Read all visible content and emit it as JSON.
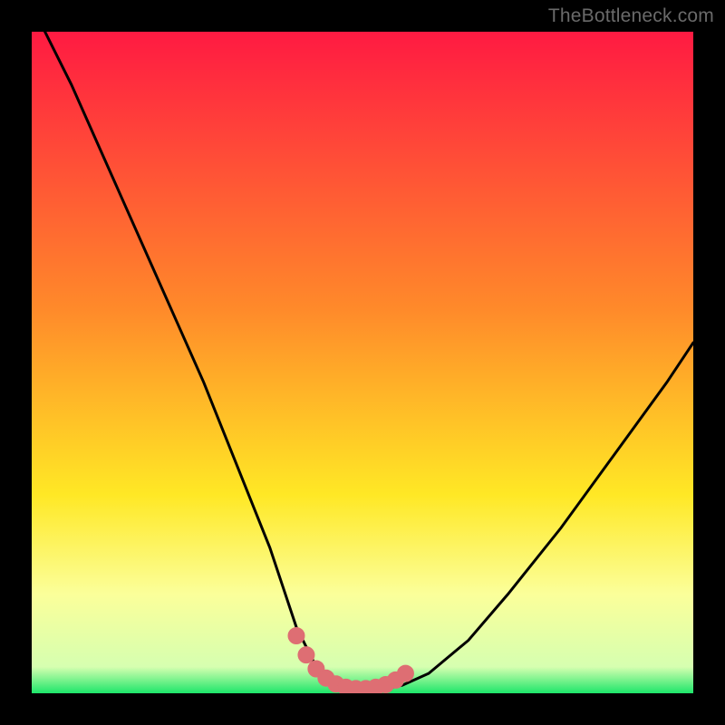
{
  "watermark": "TheBottleneck.com",
  "colors": {
    "frame": "#000000",
    "curve": "#000000",
    "marker_fill": "#de6e73",
    "marker_stroke": "#de6e73",
    "gradient_top": "#ff1a42",
    "gradient_mid1": "#ff8a2a",
    "gradient_mid2": "#ffe825",
    "gradient_band": "#fbff9a",
    "gradient_bottom": "#1de66a"
  },
  "chart_data": {
    "type": "line",
    "title": "",
    "xlabel": "",
    "ylabel": "",
    "xlim": [
      0,
      100
    ],
    "ylim": [
      0,
      100
    ],
    "series": [
      {
        "name": "bottleneck-curve",
        "x": [
          2,
          6,
          10,
          14,
          18,
          22,
          26,
          30,
          32,
          34,
          36,
          38,
          39,
          40,
          41,
          42,
          43,
          44,
          45,
          46,
          47,
          48,
          50,
          52,
          56,
          60,
          66,
          72,
          80,
          88,
          96,
          100
        ],
        "values": [
          100,
          92,
          83,
          74,
          65,
          56,
          47,
          37,
          32,
          27,
          22,
          16,
          13,
          10,
          8,
          6,
          4,
          2.5,
          1.6,
          1,
          0.6,
          0.4,
          0.3,
          0.4,
          1.2,
          3,
          8,
          15,
          25,
          36,
          47,
          53
        ]
      }
    ],
    "markers": {
      "name": "sweet-spot-points",
      "x": [
        40,
        41.5,
        43,
        44.5,
        46,
        47.5,
        49,
        50.5,
        52,
        53.5,
        55,
        56.5
      ],
      "values": [
        8.7,
        5.8,
        3.7,
        2.3,
        1.4,
        0.9,
        0.7,
        0.7,
        0.9,
        1.3,
        2.0,
        3.0
      ]
    }
  }
}
